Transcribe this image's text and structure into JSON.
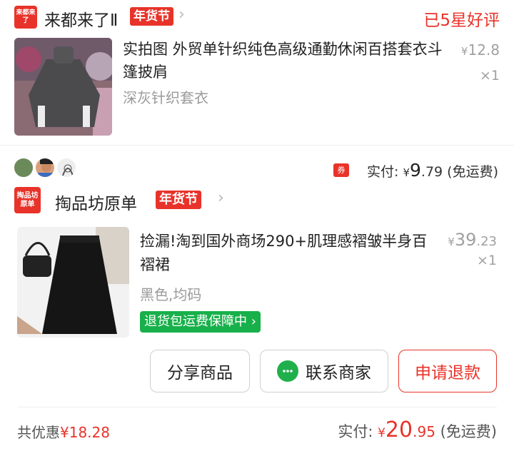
{
  "order1": {
    "shop_logo_text": "来都来了",
    "shop_name": "来都来了Ⅱ",
    "festival_badge": "年货节",
    "status": "已5星好评",
    "item": {
      "title": "实拍图 外贸单针织纯色高级通勤休闲百搭套衣斗篷披肩",
      "spec": "深灰针织套衣",
      "price_currency": "¥",
      "price": "12.8",
      "qty": "×1"
    },
    "payment": {
      "coupon_icon": "券",
      "label": "实付:",
      "currency": "¥",
      "int": "9",
      "dec": ".79",
      "shipping": "(免运费)"
    }
  },
  "order2": {
    "shop_logo_text": "掏品坊原单",
    "shop_name": "掏品坊原单",
    "festival_badge": "年货节",
    "item": {
      "title": "捡漏!淘到国外商场290+肌理感褶皱半身百褶裙",
      "spec": "黑色,均码",
      "price_currency": "¥",
      "price_int": "39",
      "price_dec": ".23",
      "qty": "×1",
      "return_badge": "退货包运费保障中"
    },
    "buttons": {
      "share": "分享商品",
      "contact": "联系商家",
      "refund": "申请退款"
    },
    "summary": {
      "discount_label": "共优惠",
      "discount_amount": "¥18.28",
      "paid_label": "实付:",
      "currency": "¥",
      "int": "20",
      "dec": ".95",
      "shipping": "(免运费)"
    }
  },
  "colors": {
    "accent_red": "#e8332a",
    "green": "#18b04a",
    "muted": "#9a9a9a"
  }
}
